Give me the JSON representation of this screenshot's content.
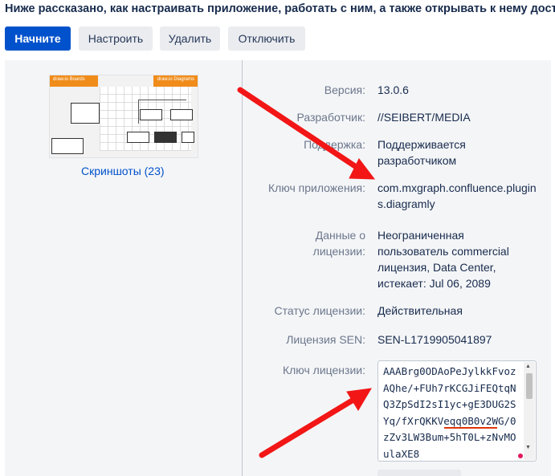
{
  "intro": "Ниже рассказано, как настраивать приложение, работать с ним, а также открывать к нему дост",
  "actions": {
    "start": "Начните",
    "configure": "Настроить",
    "delete": "Удалить",
    "disable": "Отключить"
  },
  "screenshots": {
    "link": "Скриншоты (23)",
    "thumb_left_title": "draw.io Boards",
    "thumb_right_title": "draw.io Diagrams"
  },
  "details": {
    "version_label": "Версия:",
    "version_value": "13.0.6",
    "developer_label": "Разработчик:",
    "developer_value": "//SEIBERT/MEDIA",
    "support_label": "Поддержка:",
    "support_value": "Поддерживается разработчиком",
    "app_key_label": "Ключ приложения:",
    "app_key_value": "com.mxgraph.confluence.plugins.diagramly",
    "license_data_label": "Данные о лицензии:",
    "license_data_value": "Неограниченная пользователь commercial лицензия, Data Center, истекает: Jul 06, 2089",
    "license_status_label": "Статус лицензии:",
    "license_status_value": "Действительная",
    "sen_label": "Лицензия SEN:",
    "sen_value": "SEN-L1719905041897",
    "license_key_label": "Ключ лицензии:",
    "license_key_value": "AAABrg0ODAoPeJylkkFvozAQhe/+FUh7rKCGJiFEQtqNQ3ZpSdI2sI1yc+gE3DUG2SYq/fXrQKKVeqq0B0v2WG/0zZv3LW3Bum+5hT0L+zNvMOulaXE8"
  },
  "colors": {
    "primary": "#0052cc",
    "panel_bg": "#f4f5f7",
    "arrow": "#f21616"
  }
}
